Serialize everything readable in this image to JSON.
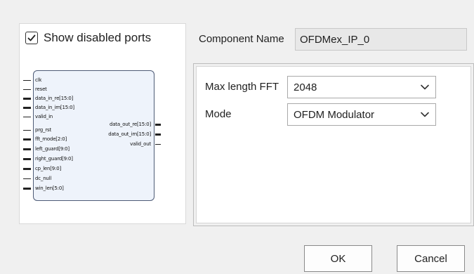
{
  "symbol_panel": {
    "show_disabled_label": "Show disabled ports",
    "show_disabled_checked": true,
    "inputs": [
      {
        "name": "clk",
        "bus": false
      },
      {
        "name": "reset",
        "bus": false
      },
      {
        "name": "data_in_re[15:0]",
        "bus": true
      },
      {
        "name": "data_in_im[15:0]",
        "bus": true
      },
      {
        "name": "valid_in",
        "bus": false
      },
      {
        "name": "prg_rst",
        "bus": false
      },
      {
        "name": "fft_mode[2:0]",
        "bus": true
      },
      {
        "name": "left_guard[9:0]",
        "bus": true
      },
      {
        "name": "right_guard[9:0]",
        "bus": true
      },
      {
        "name": "cp_len[9:0]",
        "bus": true
      },
      {
        "name": "dc_null",
        "bus": false
      },
      {
        "name": "win_len[5:0]",
        "bus": true
      }
    ],
    "outputs": [
      {
        "name": "data_out_re[15:0]",
        "bus": true
      },
      {
        "name": "data_out_im[15:0]",
        "bus": true
      },
      {
        "name": "valid_out",
        "bus": false
      }
    ]
  },
  "component": {
    "label": "Component Name",
    "value": "OFDMex_IP_0"
  },
  "params": {
    "max_length_label": "Max length FFT",
    "max_length_value": "2048",
    "mode_label": "Mode",
    "mode_value": "OFDM Modulator"
  },
  "buttons": {
    "ok": "OK",
    "cancel": "Cancel"
  },
  "icons": {
    "checkbox_check": "check-icon",
    "dropdown": "chevron-down-icon"
  },
  "colors": {
    "symbol_fill": "#eef3fb",
    "symbol_border": "#4e5b76"
  }
}
